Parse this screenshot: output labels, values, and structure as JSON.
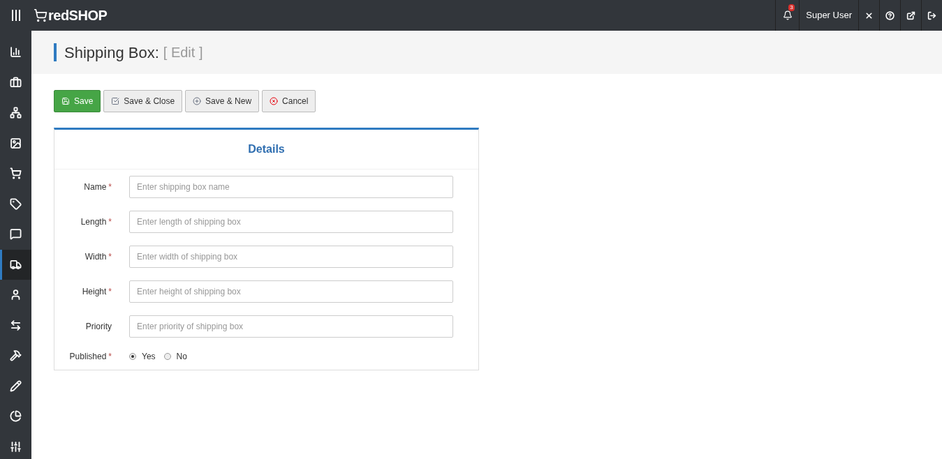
{
  "topbar": {
    "logo": "redSHOP",
    "notifications": "3",
    "user": "Super User"
  },
  "sidebar": {
    "items": [
      {
        "selected": false
      },
      {
        "selected": false
      },
      {
        "selected": false
      },
      {
        "selected": false
      },
      {
        "selected": false
      },
      {
        "selected": false
      },
      {
        "selected": false
      },
      {
        "selected": true
      },
      {
        "selected": false
      },
      {
        "selected": false
      },
      {
        "selected": false
      },
      {
        "selected": false
      },
      {
        "selected": false
      },
      {
        "selected": false
      }
    ]
  },
  "page": {
    "title": "Shipping Box:",
    "subtitle": "[ Edit ]"
  },
  "toolbar": [
    {
      "label": "Save",
      "kind": "primary"
    },
    {
      "label": "Save & Close",
      "kind": "default"
    },
    {
      "label": "Save & New",
      "kind": "default"
    },
    {
      "label": "Cancel",
      "kind": "default"
    }
  ],
  "form": {
    "title": "Details",
    "fields": [
      {
        "label": "Name",
        "required_mark": "*",
        "placeholder": "Enter shipping box name"
      },
      {
        "label": "Length",
        "required_mark": "*",
        "placeholder": "Enter length of shipping box"
      },
      {
        "label": "Width",
        "required_mark": "*",
        "placeholder": "Enter width of shipping box"
      },
      {
        "label": "Height",
        "required_mark": "*",
        "placeholder": "Enter height of shipping box"
      },
      {
        "label": "Priority",
        "placeholder": "Enter priority of shipping box"
      }
    ],
    "published": {
      "label": "Published",
      "required_mark": "*",
      "options": [
        {
          "label": "Yes",
          "selected": true
        },
        {
          "label": "No",
          "selected": false
        }
      ]
    }
  }
}
